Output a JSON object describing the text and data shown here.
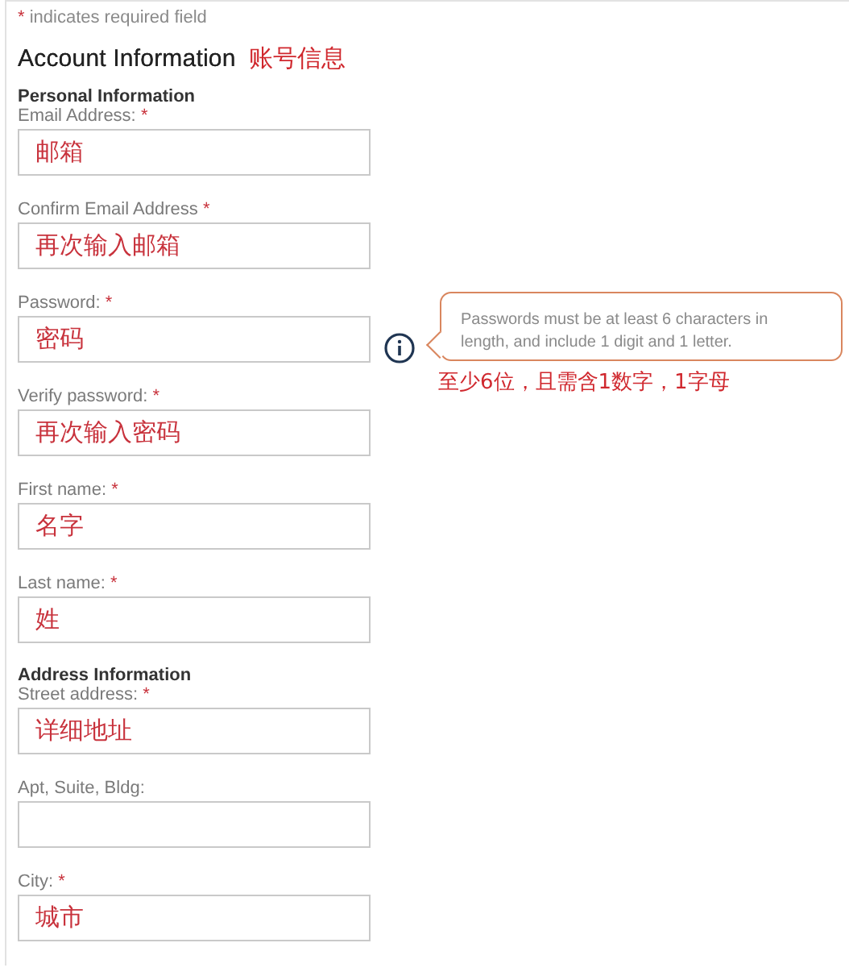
{
  "required_note": {
    "mark": "*",
    "text": "indicates required field"
  },
  "heading": {
    "title": "Account Information",
    "annotation": "账号信息"
  },
  "sections": [
    {
      "title": "Personal Information",
      "fields": [
        {
          "label": "Email Address:",
          "mark": "*",
          "value": "邮箱"
        },
        {
          "label": "Confirm Email Address",
          "mark": "*",
          "value": "再次输入邮箱"
        },
        {
          "label": "Password:",
          "mark": "*",
          "value": "密码",
          "hint": {
            "text": "Passwords must be at least 6 characters in length, and include 1 digit and 1 letter.",
            "annotation": "至少6位，且需含1数字，1字母"
          }
        },
        {
          "label": "Verify password:",
          "mark": "*",
          "value": "再次输入密码"
        },
        {
          "label": "First name:",
          "mark": "*",
          "value": "名字"
        },
        {
          "label": "Last name:",
          "mark": "*",
          "value": "姓"
        }
      ]
    },
    {
      "title": "Address Information",
      "fields": [
        {
          "label": "Street address:",
          "mark": "*",
          "value": "详细地址"
        },
        {
          "label": "Apt, Suite, Bldg:"
        },
        {
          "label": "City:",
          "mark": "*",
          "value": "城市"
        }
      ]
    }
  ]
}
